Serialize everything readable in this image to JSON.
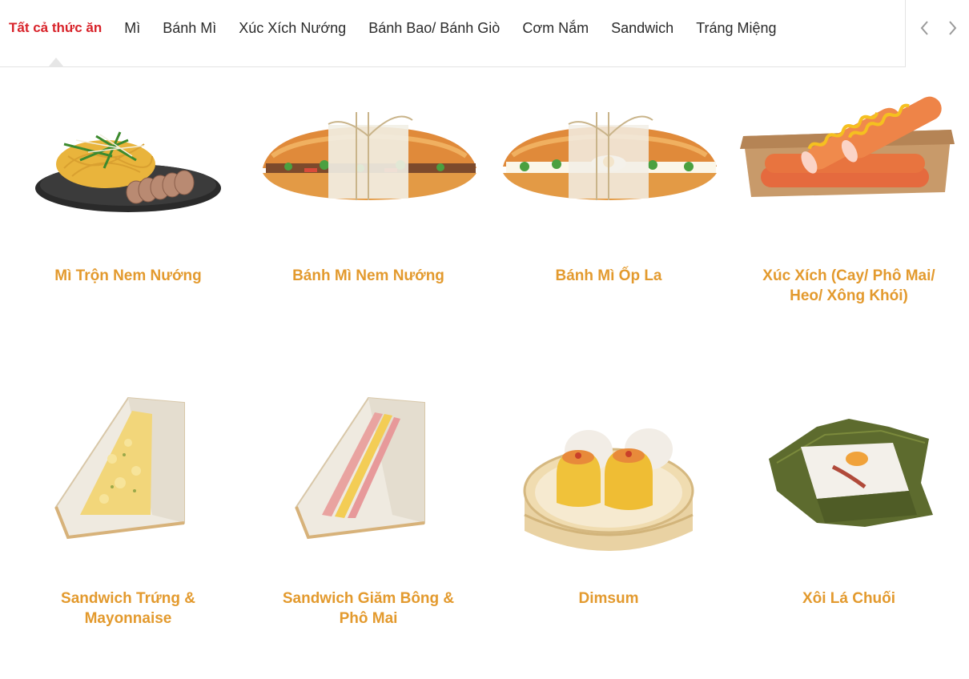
{
  "categories": {
    "tabs": [
      {
        "label": "Tất cả thức ăn",
        "active": true
      },
      {
        "label": "Mì"
      },
      {
        "label": "Bánh Mì"
      },
      {
        "label": "Xúc Xích Nướng"
      },
      {
        "label": "Bánh Bao/ Bánh Giò"
      },
      {
        "label": "Cơm Nắm"
      },
      {
        "label": "Sandwich"
      },
      {
        "label": "Tráng Miệng"
      }
    ],
    "prev_icon": "chevron-left-icon",
    "next_icon": "chevron-right-icon"
  },
  "products": [
    {
      "name": "Mì Trộn Nem Nướng",
      "image": "mixed-noodle-plate"
    },
    {
      "name": "Bánh Mì Nem Nướng",
      "image": "banh-mi-sandwich"
    },
    {
      "name": "Bánh Mì Ốp La",
      "image": "banh-mi-egg-sandwich"
    },
    {
      "name": "Xúc Xích (Cay/ Phô Mai/ Heo/ Xông Khói)",
      "image": "sausage-tray"
    },
    {
      "name": "Sandwich Trứng & Mayonnaise",
      "image": "egg-sandwich-triangle"
    },
    {
      "name": "Sandwich Giăm Bông & Phô Mai",
      "image": "ham-cheese-sandwich-triangle"
    },
    {
      "name": "Dimsum",
      "image": "dimsum-steamer"
    },
    {
      "name": "Xôi Lá Chuối",
      "image": "sticky-rice-banana-leaf"
    }
  ],
  "colors": {
    "active_tab": "#d8232a",
    "product_name": "#e39a2e"
  }
}
